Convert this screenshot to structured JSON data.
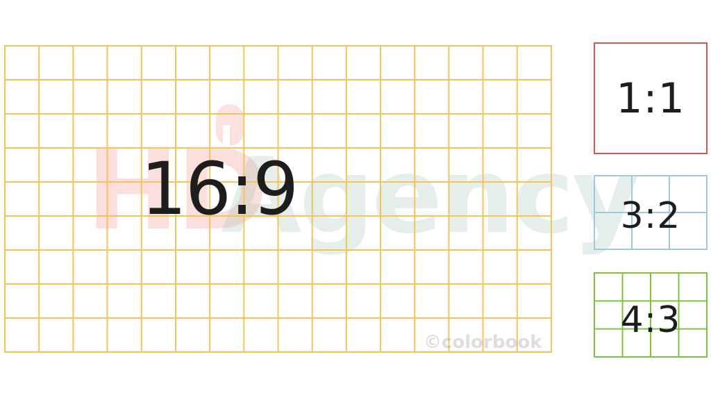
{
  "diagram": {
    "main": {
      "label": "16:9",
      "color": "#f2c45a",
      "cols": 16,
      "rows": 9
    },
    "square": {
      "label": "1:1",
      "color": "#d9534f"
    },
    "three_two": {
      "label": "3:2",
      "color": "#9ec8dc",
      "cols": 3,
      "rows": 2
    },
    "four_three": {
      "label": "4:3",
      "color": "#7dc142",
      "cols": 4,
      "rows": 3
    }
  },
  "watermark": {
    "hd": "HD",
    "agency": "Agency",
    "credit": "©colorbook"
  }
}
